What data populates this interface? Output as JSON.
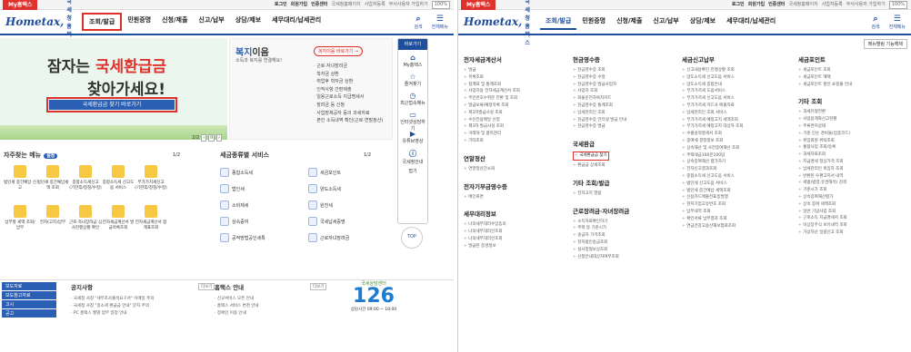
{
  "top": {
    "mytab": "My홈택스",
    "links": [
      "로그인",
      "회원가입",
      "인증센터",
      "국세청홈페이지",
      "사업자등록",
      "부서사용자 가입하기",
      "회원가입"
    ],
    "zoom": "100%"
  },
  "logo": {
    "brand": "Hometax,",
    "sub": "국세청홈택스"
  },
  "nav": [
    "조회/발급",
    "민원증명",
    "신청/제출",
    "신고/납부",
    "상담/제보",
    "세무대리/납세관리"
  ],
  "hicons": [
    "검색",
    "전체메뉴"
  ],
  "hero": {
    "line1": "잠자는 ",
    "line1_hl": "국세환급금",
    "line2": "찾아가세요!",
    "button": "국세환급금 찾기 바로가기",
    "page": "2/2"
  },
  "welfare": {
    "title_hl": "복지",
    "title": "이음",
    "sub": "소득과 복지를 연결해요!",
    "btn": "복지이음 바로가기 →",
    "items": [
      "근로·자녀장려금",
      "학자금 상환",
      "취업후 학자금 상환",
      "인적사항 간편제출",
      "일용근로소득 지급명세서",
      "장려금 등 신청",
      "사업장제공자 등의 과세자료",
      "본인 소득내역 확인(근로·연말정산)"
    ]
  },
  "side": {
    "title": "바로가기",
    "items": [
      "My홈택스",
      "즐겨찾기",
      "최근접속메뉴",
      "인터넷상담하기",
      "유튜브영상",
      "국세청안내",
      "접기"
    ],
    "top": "TOP"
  },
  "freq": {
    "title": "자주찾는 메뉴",
    "badge": "설정",
    "page": "1/2",
    "items": [
      "법인세 중간예납 신고",
      "법인세 중간예납세액 조회",
      "종합소득세신고 (기한후/정정/수정)",
      "종합소득세 신고도움 서비스",
      "부가가치세신고 (기한후/정정/수정)",
      "",
      "납부할 세액 조회/납부",
      "전자(고지)납부",
      "근로·자녀장려금 심사진행상황 확인",
      "전자세금계산서 발급목록조회",
      "전자세금계산서 합계표조회",
      ""
    ]
  },
  "tax": {
    "title": "세금종류별 서비스",
    "page": "1/2",
    "items": [
      "종합소득세",
      "세금포인트",
      "법인세",
      "양도소득세",
      "소비제세",
      "원천세",
      "상속증여",
      "국세납세증명",
      "공적방법공인세특",
      "근로자녀장려금"
    ]
  },
  "bottom": {
    "list": [
      "보도자료",
      "보도참고자료",
      "고시",
      "공고"
    ],
    "notice_title": "공지사항",
    "notice_items": [
      "국세청 사칭 \"세무조사출석요구서\" 이메일 주의",
      "국세청 사칭 \"종소세 환급금 안내\" 문자 주의",
      "PC 홈택스 월별 업무 일정 안내"
    ],
    "hometax_title": "홈택스 안내",
    "hometax_items": [
      "신규서비스 오픈 안내",
      "홈택스 서비스 변경 안내",
      "장애인 이용 안내"
    ],
    "more": "더보기",
    "call_title": "국세상담센터",
    "call_num": "126",
    "call_sub": "상담시간 09:00 ~ 18:00"
  },
  "right": {
    "func_btn": "메뉴별림 기능해제",
    "col1": [
      {
        "h": "전자세금계산서",
        "items": [
          "발급",
          "목록조회",
          "합계표 및 통계조회",
          "사업자용 전자세금계산서 조회",
          "주민번호수취분 전환 및 조회",
          "발급보류/예정목록 조회",
          "제3자발급사실 조회",
          "수신전용메일 신청",
          "제3자 발급사실 조회",
          "거래처 및 품목관리",
          "기타조회"
        ]
      },
      {
        "h": "연말정산",
        "items": [
          "연말정산간소화"
        ]
      },
      {
        "h": "전자기부금영수증",
        "items": [
          "메인화면"
        ]
      },
      {
        "h": "세무대리정보",
        "items": [
          "나의세무대리수임동의",
          "나의세무대리인조회",
          "나의세무대리인조회",
          "발급된 증명정보"
        ]
      }
    ],
    "col2": [
      {
        "h": "현금영수증",
        "items": [
          "현금영수증 조회",
          "현금영수증 수정",
          "현금영수증 발급사업자",
          "사업자 조회",
          "화물운전자복지카드",
          "현금영수증 통계조회",
          "납세관리인 조회",
          "현금영수증 인터넷 발급 안내",
          "현금영수증 발급"
        ]
      },
      {
        "h": "국세환급",
        "items": [
          "국세환급금 찾기",
          "환급금 상세조회"
        ]
      },
      {
        "h": "기타 조회/발급",
        "items": [
          "전자고지 열람"
        ]
      },
      {
        "h": "근로장려금·자녀장려금",
        "items": [
          "소득자료확인하기",
          "주택 등 기준시가",
          "송금자 가격조회",
          "현지법인송금조회",
          "실사정형보상조회",
          "신청안내대상자여부조회"
        ]
      }
    ],
    "col3": [
      {
        "h": "세금신고납부",
        "items": [
          "신고내용확인 진행상황 조회",
          "양도소득세 신고도움 서비스",
          "양도소득세 종합안내",
          "부가가치세 도움서비스",
          "부가가치세 신고도움 서비스",
          "부가가치세 카드사 매출자료",
          "납세관리인 조회 서비스",
          "부가가치세 예정고지 세액조회",
          "부가가치세 예정고지 대상자 조회",
          "수출실적명세서 조회",
          "중여세 결정정보 조회",
          "상속재산 및 사전증여재산 조회",
          "주택세금100문100답",
          "상속증여재산 평가하기",
          "전자신고결과조회",
          "종합소득세 신고도움 서비스",
          "법인세 신고도움 서비스",
          "법인세 중간예납 세액조회",
          "신용카드매출전표등발행",
          "현지기업고유번호 조회",
          "납부내역 조회",
          "확인서류 납부결과 조회",
          "연금건강고용산재보험료조회"
        ]
      }
    ],
    "col4": [
      {
        "h": "세금포인트",
        "items": [
          "세금포인트 조회",
          "세금포인트 혜택",
          "세금포인트 할인 쇼핑몰 안내"
        ]
      },
      {
        "h": "기타 조회",
        "items": [
          "과세유형전환",
          "사업용계좌신고현황",
          "주류면허상태",
          "기준 단순 경비율(업종코드)",
          "위임회원 위탁조회",
          "통합사업 조회/등록",
          "과세자료조회",
          "지급명세 정상가격 조회",
          "납세관리인 위임자 조회",
          "반환된 우편고지서 내역",
          "세법(법령,유권해석) 검색",
          "기준시가 조회",
          "상속증여재산평가",
          "상속 증여 세액조회",
          "일반 기념사업 조회",
          "근로소득 지급명세서 조회",
          "비상장주식 보유내역 조회",
          "가상자산 일괄신고 조회"
        ]
      }
    ]
  }
}
